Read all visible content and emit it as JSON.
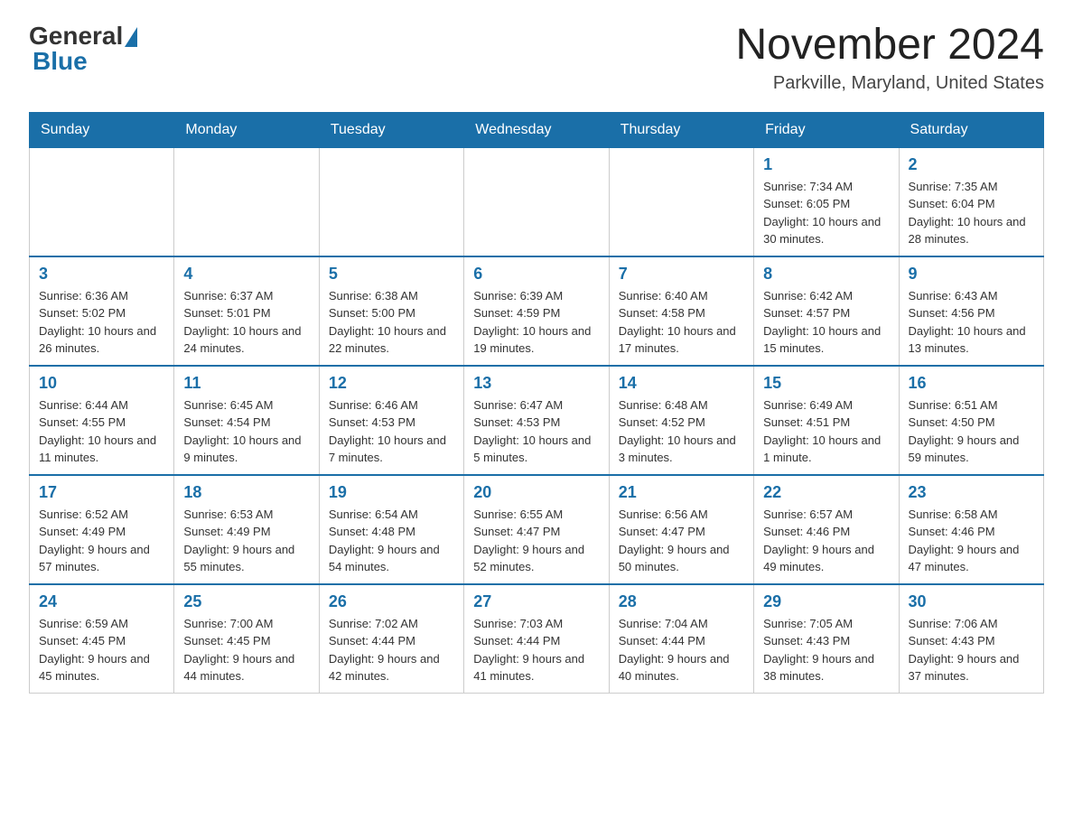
{
  "logo": {
    "general": "General",
    "blue": "Blue"
  },
  "header": {
    "title": "November 2024",
    "location": "Parkville, Maryland, United States"
  },
  "days_of_week": [
    "Sunday",
    "Monday",
    "Tuesday",
    "Wednesday",
    "Thursday",
    "Friday",
    "Saturday"
  ],
  "weeks": [
    [
      {
        "day": "",
        "sunrise": "",
        "sunset": "",
        "daylight": ""
      },
      {
        "day": "",
        "sunrise": "",
        "sunset": "",
        "daylight": ""
      },
      {
        "day": "",
        "sunrise": "",
        "sunset": "",
        "daylight": ""
      },
      {
        "day": "",
        "sunrise": "",
        "sunset": "",
        "daylight": ""
      },
      {
        "day": "",
        "sunrise": "",
        "sunset": "",
        "daylight": ""
      },
      {
        "day": "1",
        "sunrise": "Sunrise: 7:34 AM",
        "sunset": "Sunset: 6:05 PM",
        "daylight": "Daylight: 10 hours and 30 minutes."
      },
      {
        "day": "2",
        "sunrise": "Sunrise: 7:35 AM",
        "sunset": "Sunset: 6:04 PM",
        "daylight": "Daylight: 10 hours and 28 minutes."
      }
    ],
    [
      {
        "day": "3",
        "sunrise": "Sunrise: 6:36 AM",
        "sunset": "Sunset: 5:02 PM",
        "daylight": "Daylight: 10 hours and 26 minutes."
      },
      {
        "day": "4",
        "sunrise": "Sunrise: 6:37 AM",
        "sunset": "Sunset: 5:01 PM",
        "daylight": "Daylight: 10 hours and 24 minutes."
      },
      {
        "day": "5",
        "sunrise": "Sunrise: 6:38 AM",
        "sunset": "Sunset: 5:00 PM",
        "daylight": "Daylight: 10 hours and 22 minutes."
      },
      {
        "day": "6",
        "sunrise": "Sunrise: 6:39 AM",
        "sunset": "Sunset: 4:59 PM",
        "daylight": "Daylight: 10 hours and 19 minutes."
      },
      {
        "day": "7",
        "sunrise": "Sunrise: 6:40 AM",
        "sunset": "Sunset: 4:58 PM",
        "daylight": "Daylight: 10 hours and 17 minutes."
      },
      {
        "day": "8",
        "sunrise": "Sunrise: 6:42 AM",
        "sunset": "Sunset: 4:57 PM",
        "daylight": "Daylight: 10 hours and 15 minutes."
      },
      {
        "day": "9",
        "sunrise": "Sunrise: 6:43 AM",
        "sunset": "Sunset: 4:56 PM",
        "daylight": "Daylight: 10 hours and 13 minutes."
      }
    ],
    [
      {
        "day": "10",
        "sunrise": "Sunrise: 6:44 AM",
        "sunset": "Sunset: 4:55 PM",
        "daylight": "Daylight: 10 hours and 11 minutes."
      },
      {
        "day": "11",
        "sunrise": "Sunrise: 6:45 AM",
        "sunset": "Sunset: 4:54 PM",
        "daylight": "Daylight: 10 hours and 9 minutes."
      },
      {
        "day": "12",
        "sunrise": "Sunrise: 6:46 AM",
        "sunset": "Sunset: 4:53 PM",
        "daylight": "Daylight: 10 hours and 7 minutes."
      },
      {
        "day": "13",
        "sunrise": "Sunrise: 6:47 AM",
        "sunset": "Sunset: 4:53 PM",
        "daylight": "Daylight: 10 hours and 5 minutes."
      },
      {
        "day": "14",
        "sunrise": "Sunrise: 6:48 AM",
        "sunset": "Sunset: 4:52 PM",
        "daylight": "Daylight: 10 hours and 3 minutes."
      },
      {
        "day": "15",
        "sunrise": "Sunrise: 6:49 AM",
        "sunset": "Sunset: 4:51 PM",
        "daylight": "Daylight: 10 hours and 1 minute."
      },
      {
        "day": "16",
        "sunrise": "Sunrise: 6:51 AM",
        "sunset": "Sunset: 4:50 PM",
        "daylight": "Daylight: 9 hours and 59 minutes."
      }
    ],
    [
      {
        "day": "17",
        "sunrise": "Sunrise: 6:52 AM",
        "sunset": "Sunset: 4:49 PM",
        "daylight": "Daylight: 9 hours and 57 minutes."
      },
      {
        "day": "18",
        "sunrise": "Sunrise: 6:53 AM",
        "sunset": "Sunset: 4:49 PM",
        "daylight": "Daylight: 9 hours and 55 minutes."
      },
      {
        "day": "19",
        "sunrise": "Sunrise: 6:54 AM",
        "sunset": "Sunset: 4:48 PM",
        "daylight": "Daylight: 9 hours and 54 minutes."
      },
      {
        "day": "20",
        "sunrise": "Sunrise: 6:55 AM",
        "sunset": "Sunset: 4:47 PM",
        "daylight": "Daylight: 9 hours and 52 minutes."
      },
      {
        "day": "21",
        "sunrise": "Sunrise: 6:56 AM",
        "sunset": "Sunset: 4:47 PM",
        "daylight": "Daylight: 9 hours and 50 minutes."
      },
      {
        "day": "22",
        "sunrise": "Sunrise: 6:57 AM",
        "sunset": "Sunset: 4:46 PM",
        "daylight": "Daylight: 9 hours and 49 minutes."
      },
      {
        "day": "23",
        "sunrise": "Sunrise: 6:58 AM",
        "sunset": "Sunset: 4:46 PM",
        "daylight": "Daylight: 9 hours and 47 minutes."
      }
    ],
    [
      {
        "day": "24",
        "sunrise": "Sunrise: 6:59 AM",
        "sunset": "Sunset: 4:45 PM",
        "daylight": "Daylight: 9 hours and 45 minutes."
      },
      {
        "day": "25",
        "sunrise": "Sunrise: 7:00 AM",
        "sunset": "Sunset: 4:45 PM",
        "daylight": "Daylight: 9 hours and 44 minutes."
      },
      {
        "day": "26",
        "sunrise": "Sunrise: 7:02 AM",
        "sunset": "Sunset: 4:44 PM",
        "daylight": "Daylight: 9 hours and 42 minutes."
      },
      {
        "day": "27",
        "sunrise": "Sunrise: 7:03 AM",
        "sunset": "Sunset: 4:44 PM",
        "daylight": "Daylight: 9 hours and 41 minutes."
      },
      {
        "day": "28",
        "sunrise": "Sunrise: 7:04 AM",
        "sunset": "Sunset: 4:44 PM",
        "daylight": "Daylight: 9 hours and 40 minutes."
      },
      {
        "day": "29",
        "sunrise": "Sunrise: 7:05 AM",
        "sunset": "Sunset: 4:43 PM",
        "daylight": "Daylight: 9 hours and 38 minutes."
      },
      {
        "day": "30",
        "sunrise": "Sunrise: 7:06 AM",
        "sunset": "Sunset: 4:43 PM",
        "daylight": "Daylight: 9 hours and 37 minutes."
      }
    ]
  ]
}
